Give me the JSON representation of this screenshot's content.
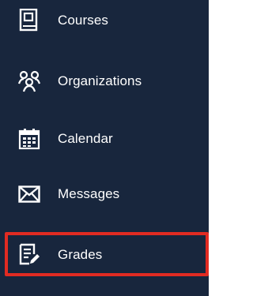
{
  "nav": {
    "items": [
      {
        "label": "Courses",
        "icon": "courses-icon"
      },
      {
        "label": "Organizations",
        "icon": "organizations-icon"
      },
      {
        "label": "Calendar",
        "icon": "calendar-icon"
      },
      {
        "label": "Messages",
        "icon": "messages-icon"
      },
      {
        "label": "Grades",
        "icon": "grades-icon"
      }
    ],
    "highlighted": "Grades"
  },
  "colors": {
    "sidebar_bg": "#18263d",
    "text": "#ffffff",
    "highlight": "#e12b22"
  }
}
